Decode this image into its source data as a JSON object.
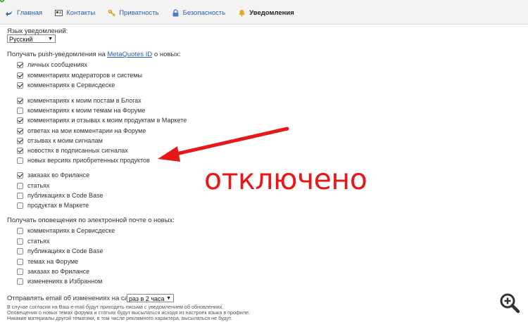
{
  "colors": {
    "accent": "#2a5db0",
    "annotation": "#e81818"
  },
  "tabs": [
    {
      "label": "Главная",
      "icon": "back-arrow-icon"
    },
    {
      "label": "Контакты",
      "icon": "contacts-card-icon"
    },
    {
      "label": "Приватность",
      "icon": "key-icon"
    },
    {
      "label": "Безопасность",
      "icon": "lock-icon"
    },
    {
      "label": "Уведомления",
      "icon": "bell-icon",
      "active": true
    }
  ],
  "language": {
    "label": "Язык уведомлений:",
    "value": "Русский"
  },
  "push": {
    "heading_prefix": "Получать push-уведомления на",
    "heading_link": "MetaQuotes ID",
    "heading_suffix": "о новых:",
    "items": [
      {
        "label": "личных сообщениях",
        "checked": true
      },
      {
        "label": "комментариях модераторов и системы",
        "checked": true
      },
      {
        "label": "комментариях в Сервисдеске",
        "checked": true
      },
      {
        "label": "комментариях к моим постам в Блогах",
        "checked": true
      },
      {
        "label": "комментариях к моим темам на Форуме",
        "checked": false
      },
      {
        "label": "комментариях и отзывах к моим продуктам в Маркете",
        "checked": true
      },
      {
        "label": "ответах на мои комментарии на Форуме",
        "checked": true
      },
      {
        "label": "отзывах к моим сигналам",
        "checked": true
      },
      {
        "label": "новостях в подписанных сигналах",
        "checked": true
      },
      {
        "label": "новых версиях приобретенных продуктов",
        "checked": false
      },
      {
        "label": "заказах во Фрилансе",
        "checked": true
      },
      {
        "label": "статьях",
        "checked": false
      },
      {
        "label": "публикациях в Code Base",
        "checked": false
      },
      {
        "label": "продуктах в Маркете",
        "checked": false
      }
    ]
  },
  "email": {
    "heading": "Получать оповещения по электронной почте о новых:",
    "items": [
      {
        "label": "комментариях в Сервисдеске",
        "checked": false
      },
      {
        "label": "статьях",
        "checked": false
      },
      {
        "label": "публикациях в Code Base",
        "checked": false
      },
      {
        "label": "темах на Форуме",
        "checked": false
      },
      {
        "label": "заказах во Фрилансе",
        "checked": false
      },
      {
        "label": "изменениях в Избранном",
        "checked": false
      }
    ],
    "frequency_label": "Отправлять email об изменениях на сайте:",
    "frequency_value": "раз в 2 часа"
  },
  "notes": [
    "В случае согласия на Ваш e-mail будут приходить письма с уведомлением об обновлениях.",
    "Оповещения о новых темах форума и статьях будут высылаться исходя из настроек языка в профиле.",
    "Никакие материалы другой тематики, в том числе рекламного характера, высылаться не будут."
  ],
  "annotation": {
    "text": "отключено"
  }
}
